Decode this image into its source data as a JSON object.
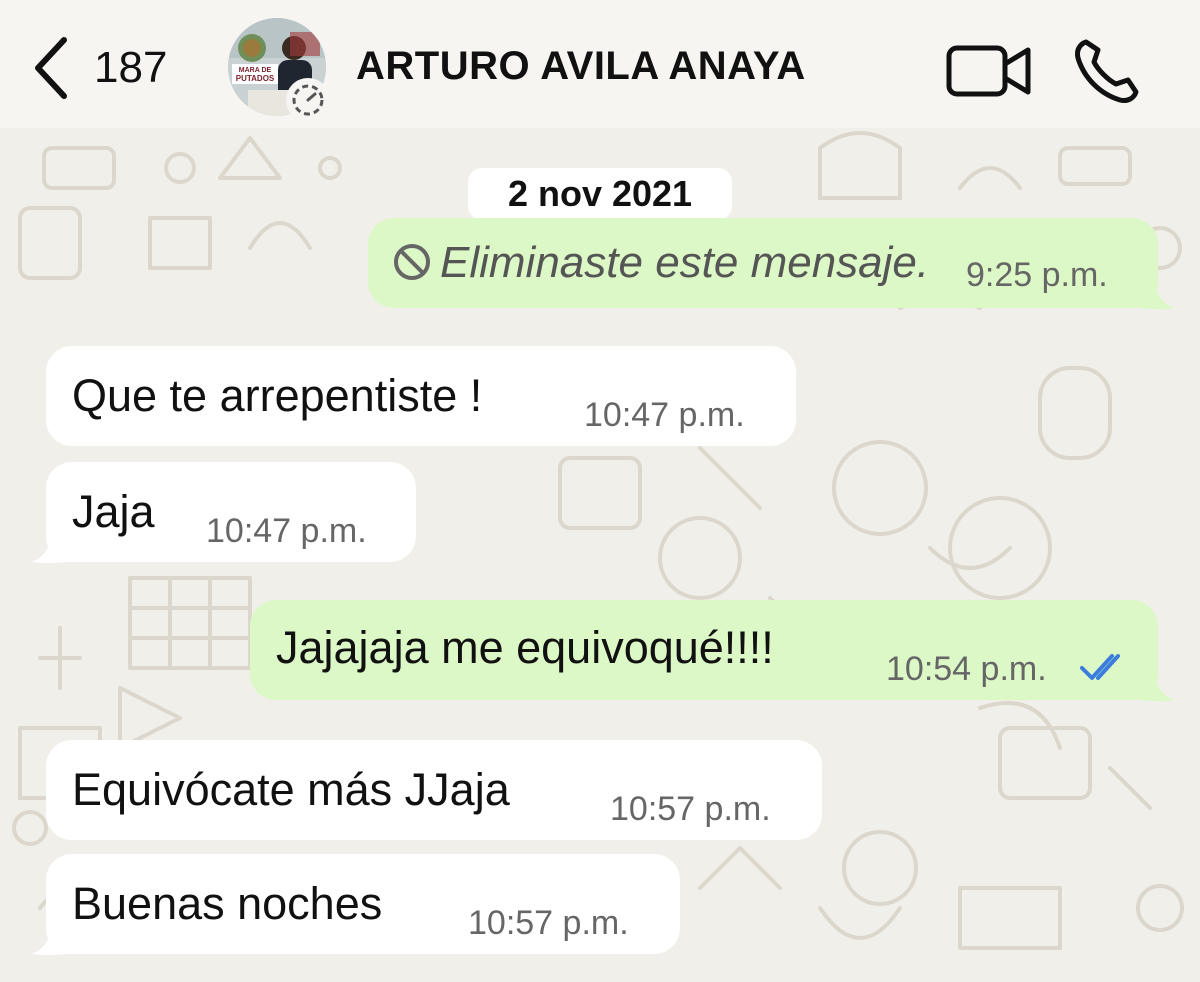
{
  "header": {
    "back_count": "187",
    "contact_name": "ARTURO AVILA ANAYA",
    "avatar_text": "MARA DE PUTADOS"
  },
  "chat": {
    "date_separator": "2 nov 2021",
    "messages": [
      {
        "direction": "out",
        "text": "Eliminaste este mensaje.",
        "time": "9:25 p.m.",
        "deleted": true
      },
      {
        "direction": "in",
        "text": "Que te arrepentiste !",
        "time": "10:47 p.m."
      },
      {
        "direction": "in",
        "text": "Jaja",
        "time": "10:47 p.m."
      },
      {
        "direction": "out",
        "text": "Jajajaja me equivoqué!!!!",
        "time": "10:54 p.m.",
        "status": "read"
      },
      {
        "direction": "in",
        "text": "Equivócate más JJaja",
        "time": "10:57 p.m."
      },
      {
        "direction": "in",
        "text": "Buenas noches",
        "time": "10:57 p.m."
      }
    ]
  },
  "colors": {
    "incoming_bubble": "#ffffff",
    "outgoing_bubble": "#dcf8c6",
    "read_ticks": "#3b7ddd",
    "wallpaper": "#f1efe9"
  }
}
